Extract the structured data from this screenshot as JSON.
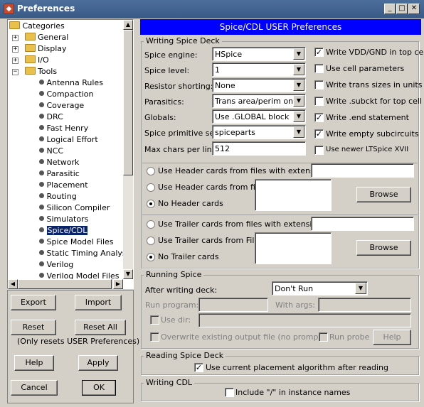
{
  "window": {
    "title": "Preferences",
    "controls": [
      "minimize-icon",
      "maximize-icon",
      "close-icon"
    ]
  },
  "tree": {
    "root": "Categories",
    "items": [
      {
        "label": "General",
        "type": "folder",
        "expanded": false
      },
      {
        "label": "Display",
        "type": "folder",
        "expanded": false
      },
      {
        "label": "I/O",
        "type": "folder",
        "expanded": false
      },
      {
        "label": "Tools",
        "type": "folder",
        "expanded": true
      }
    ],
    "tools": [
      "Antenna Rules",
      "Compaction",
      "Coverage",
      "DRC",
      "Fast Henry",
      "Logical Effort",
      "NCC",
      "Network",
      "Parasitic",
      "Placement",
      "Routing",
      "Silicon Compiler",
      "Simulators",
      "Spice/CDL",
      "Spice Model Files",
      "Static Timing Analysis",
      "Verilog",
      "Verilog Model Files"
    ],
    "selected": "Spice/CDL"
  },
  "left_buttons": {
    "export": "Export",
    "import": "Import",
    "reset": "Reset",
    "reset_all": "Reset All",
    "reset_note": "(Only resets USER Preferences)",
    "help": "Help",
    "apply": "Apply",
    "cancel": "Cancel",
    "ok": "OK"
  },
  "header": "Spice/CDL USER Preferences",
  "writing_deck": {
    "title": "Writing Spice Deck",
    "engine_label": "Spice engine:",
    "engine_value": "HSpice",
    "level_label": "Spice level:",
    "level_value": "1",
    "resistor_label": "Resistor shorting:",
    "resistor_value": "None",
    "parasitics_label": "Parasitics:",
    "parasitics_value": "Trans area/perim only",
    "globals_label": "Globals:",
    "globals_value": "Use .GLOBAL block",
    "primitive_label": "Spice primitive set:",
    "primitive_value": "spiceparts",
    "maxchars_label": "Max chars per line:",
    "maxchars_value": "512",
    "checks": [
      {
        "label": "Write VDD/GND in top cell",
        "checked": true
      },
      {
        "label": "Use cell parameters",
        "checked": false
      },
      {
        "label": "Write trans sizes in units",
        "checked": false
      },
      {
        "label": "Write .subckt for top cell",
        "checked": false
      },
      {
        "label": "Write .end statement",
        "checked": true
      },
      {
        "label": "Write empty subcircuits",
        "checked": true
      },
      {
        "label": "Use newer LTSpice XVII",
        "checked": false
      }
    ],
    "header_ext": "Use Header cards from files with extension:",
    "header_file": "Use Header cards from file:",
    "no_header": "No Header cards",
    "trailer_ext": "Use Trailer cards from files with extension:",
    "trailer_file": "Use Trailer cards from File:",
    "no_trailer": "No Trailer cards",
    "browse": "Browse"
  },
  "running": {
    "title": "Running Spice",
    "after_label": "After writing deck:",
    "after_value": "Don't Run",
    "program_label": "Run program:",
    "args_label": "With args:",
    "usedir_label": "Use dir:",
    "overwrite_label": "Overwrite existing output file (no prompts)",
    "probe_label": "Run probe",
    "help": "Help"
  },
  "reading": {
    "title": "Reading Spice Deck",
    "check_label": "Use current placement algorithm after reading",
    "checked": true
  },
  "cdl": {
    "title": "Writing CDL",
    "check_label": "Include \"/\" in instance names",
    "checked": false
  }
}
